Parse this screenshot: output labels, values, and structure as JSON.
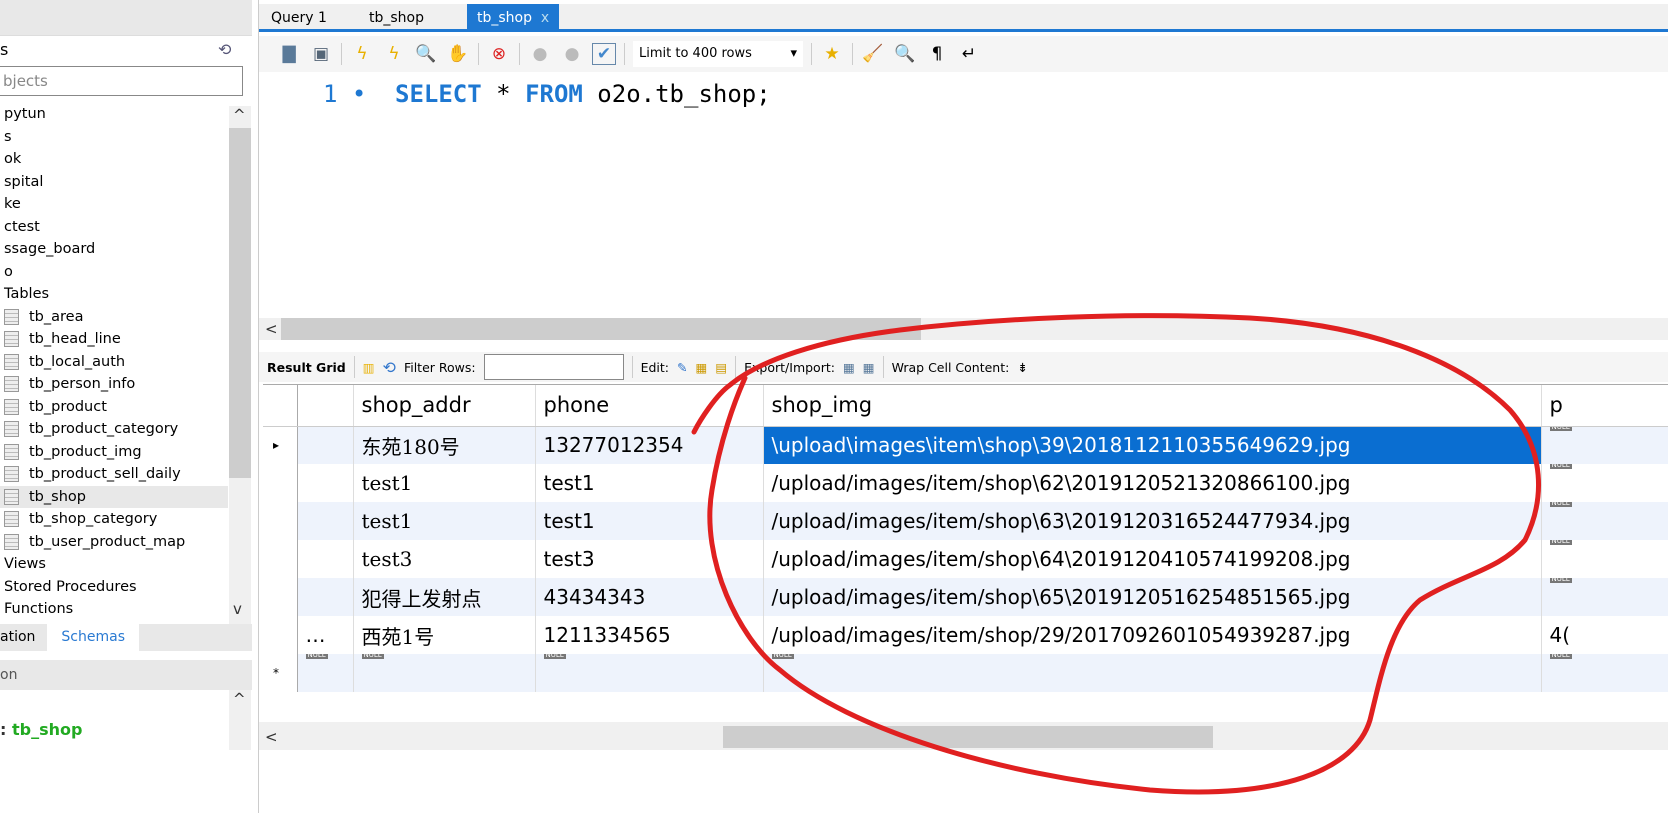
{
  "sidebar": {
    "title": "s",
    "filter_placeholder": "bjects",
    "schemas": [
      "pytun",
      "s",
      "ok",
      "spital",
      "ke",
      "ctest",
      "ssage_board",
      "o"
    ],
    "tables_label": "Tables",
    "tables": [
      "tb_area",
      "tb_head_line",
      "tb_local_auth",
      "tb_person_info",
      "tb_product",
      "tb_product_category",
      "tb_product_img",
      "tb_product_sell_daily",
      "tb_shop",
      "tb_shop_category",
      "tb_user_product_map"
    ],
    "selected_table": "tb_shop",
    "other": [
      "Views",
      "Stored Procedures",
      "Functions"
    ],
    "tabs": [
      "ation",
      "Schemas"
    ],
    "info_header": "on",
    "info_prefix": ":",
    "info_name": "tb_shop"
  },
  "tabs": [
    {
      "label": "Query 1"
    },
    {
      "label": "tb_shop"
    },
    {
      "label": "tb_shop",
      "active": true,
      "close": "x"
    }
  ],
  "toolbar": {
    "limit": "Limit to 400 rows"
  },
  "editor": {
    "line": "1",
    "dot": "•",
    "kw1": "SELECT",
    "star": " * ",
    "kw2": "FROM",
    "rest": " o2o.tb_shop;"
  },
  "result_toolbar": {
    "result_grid": "Result Grid",
    "filter_rows": "Filter Rows:",
    "edit": "Edit:",
    "export": "Export/Import:",
    "wrap": "Wrap Cell Content:"
  },
  "grid": {
    "columns": [
      "",
      "shop_addr",
      "phone",
      "shop_img",
      "p"
    ],
    "null_label": "NULL",
    "rows": [
      {
        "c0": "",
        "addr": "东苑180号",
        "phone": "13277012354",
        "img": "\\upload\\images\\item\\shop\\39\\2018112110355649629.jpg",
        "p": "NULL"
      },
      {
        "c0": "",
        "addr": "test1",
        "phone": "test1",
        "img": "/upload/images/item/shop\\62\\2019120521320866100.jpg",
        "p": "NULL"
      },
      {
        "c0": "",
        "addr": "test1",
        "phone": "test1",
        "img": "/upload/images/item/shop\\63\\2019120316524477934.jpg",
        "p": "NULL"
      },
      {
        "c0": "",
        "addr": "test3",
        "phone": "test3",
        "img": "/upload/images/item/shop\\64\\2019120410574199208.jpg",
        "p": "NULL"
      },
      {
        "c0": "",
        "addr": "犯得上发射点",
        "phone": "43434343",
        "img": "/upload/images/item/shop\\65\\2019120516254851565.jpg",
        "p": "NULL"
      },
      {
        "c0": "…",
        "addr": "西苑1号",
        "phone": "1211334565",
        "img": "/upload/images/item/shop/29/2017092601054939287.jpg",
        "p": "4("
      }
    ]
  },
  "annotation_color": "#e02020",
  "selection_color": "#0a6ed1"
}
